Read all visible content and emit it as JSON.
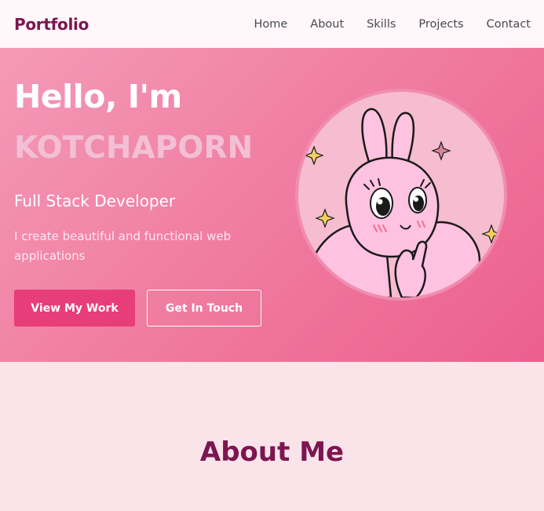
{
  "nav": {
    "logo": "Portfolio",
    "links": [
      "Home",
      "About",
      "Skills",
      "Projects",
      "Contact"
    ]
  },
  "hero": {
    "greeting": "Hello, I'm",
    "name": "KOTCHAPORN",
    "role": "Full Stack Developer",
    "description": "I create beautiful and functional web applications",
    "primary_button": "View My Work",
    "secondary_button": "Get In Touch"
  },
  "about": {
    "title": "About Me"
  },
  "colors": {
    "brand": "#7d1550",
    "accent": "#e73d78",
    "hero_gradient_start": "#f49ab7",
    "hero_gradient_end": "#ec5f8e",
    "name_color": "#f3bfd4",
    "page_background": "#fbe3ea"
  }
}
